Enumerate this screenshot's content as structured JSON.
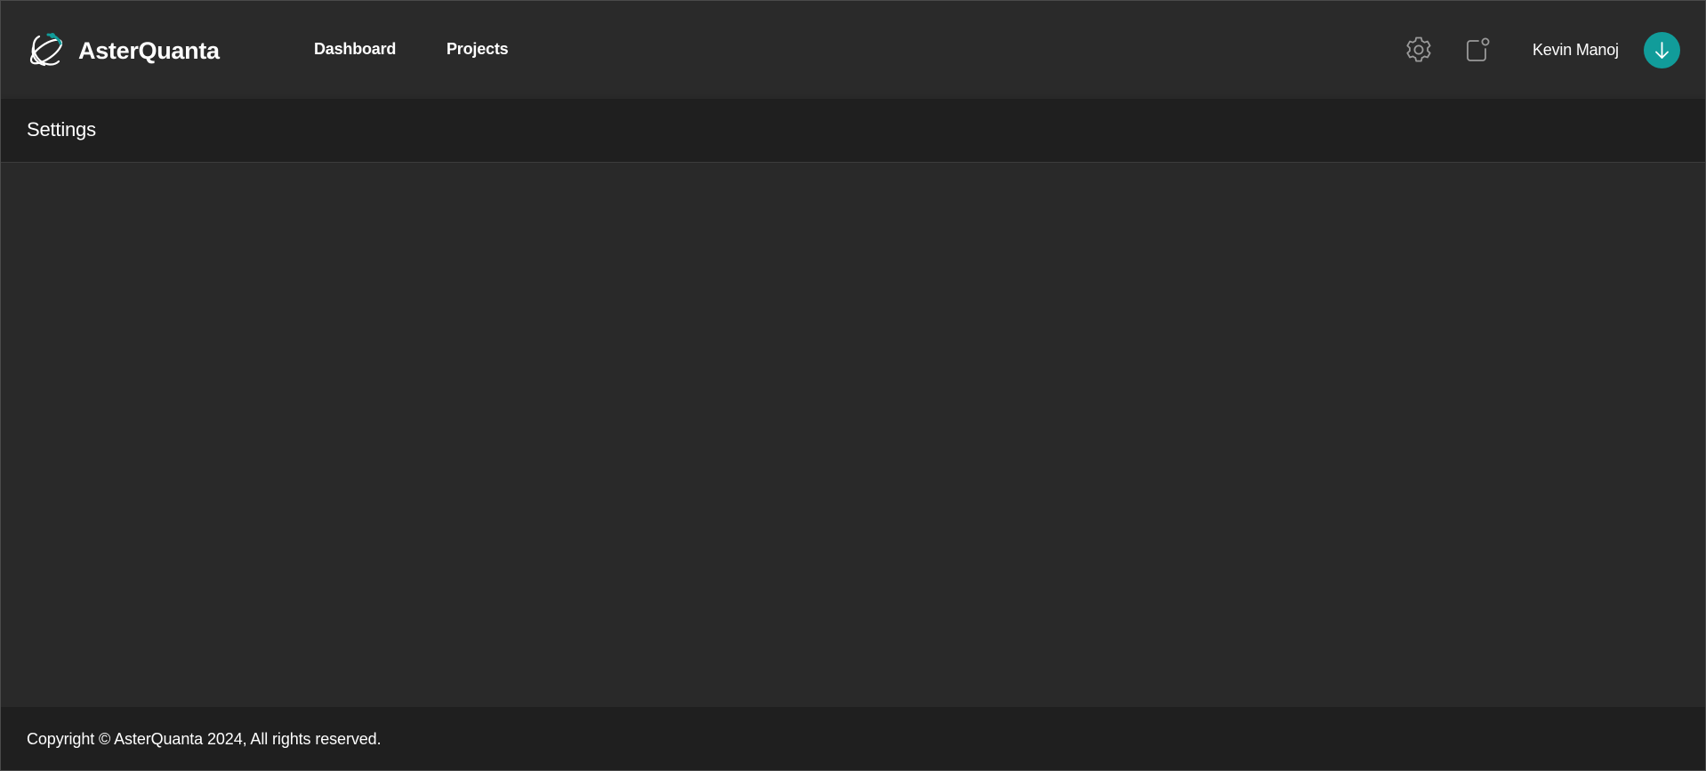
{
  "header": {
    "brand_name": "AsterQuanta",
    "brand_logo_icon": "atom-orbit-logo-icon",
    "nav": [
      {
        "label": "Dashboard"
      },
      {
        "label": "Projects"
      }
    ],
    "settings_icon": "gear-icon",
    "notifications_icon": "notification-badge-icon",
    "user_name": "Kevin Manoj",
    "avatar_icon": "arrow-down-icon",
    "avatar_color": "#119c9a"
  },
  "subheader": {
    "title": "Settings"
  },
  "footer": {
    "copyright": "Copyright © AsterQuanta 2024, All rights reserved."
  },
  "colors": {
    "background": "#282828",
    "topbar": "#2a2a2a",
    "subheader": "#1f1f1f",
    "footer": "#1f1f1f",
    "accent": "#119c9a",
    "text": "#ffffff"
  }
}
